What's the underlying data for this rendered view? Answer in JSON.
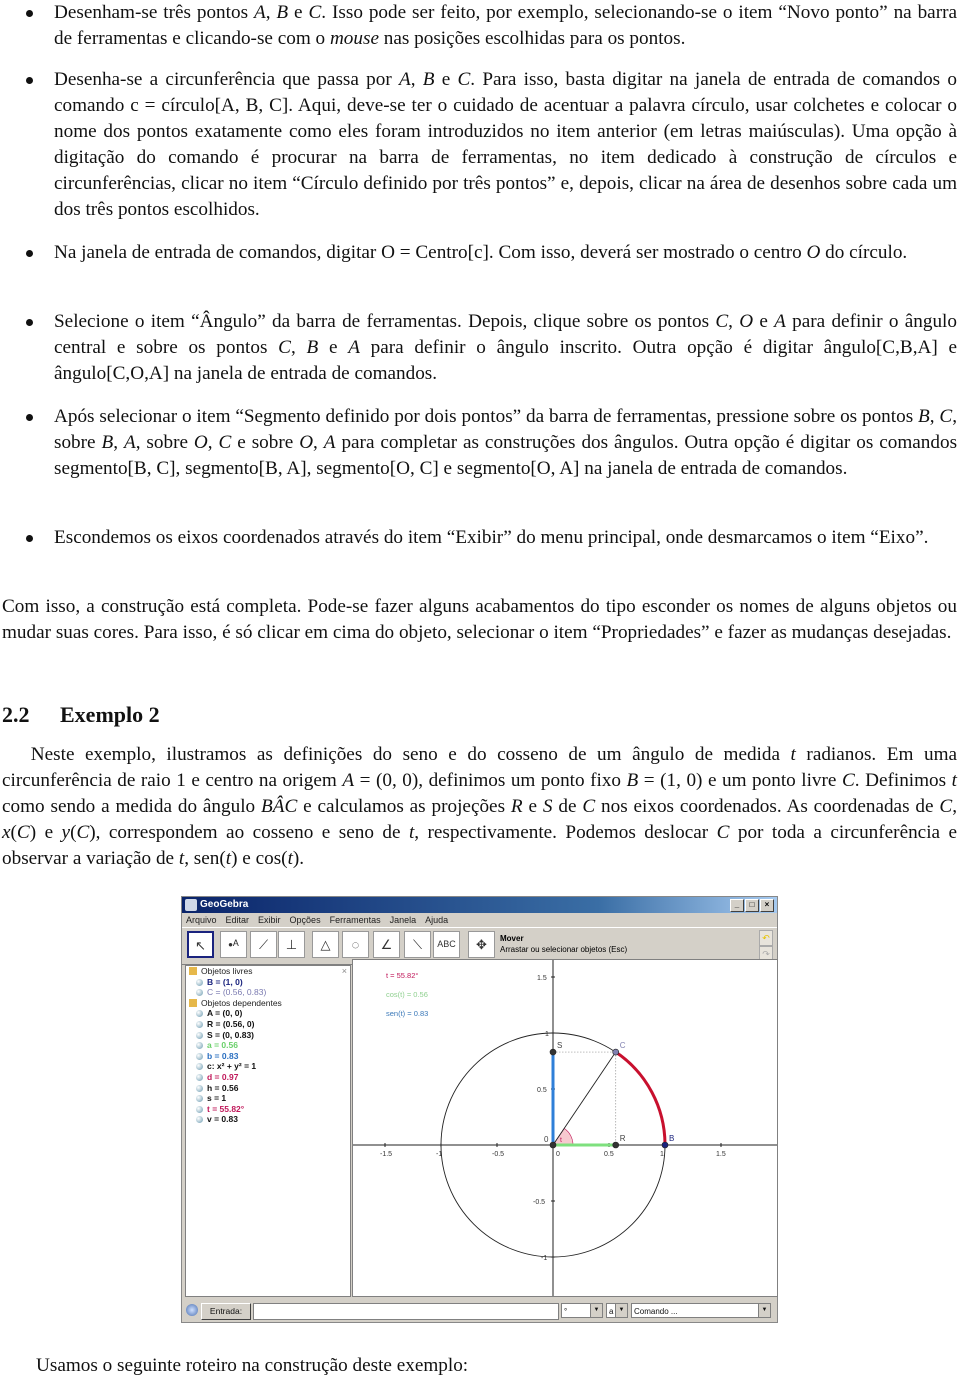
{
  "bullets": [
    {
      "html": "Desenham-se três pontos <i>A</i>, <i>B</i> e <i>C</i>. Isso pode ser feito, por exemplo, selecionando-se o item “Novo ponto” na barra de ferramentas e clicando-se com o <i>mouse</i> nas posições escolhidas para os pontos."
    },
    {
      "html": "Desenha-se a circunferência que passa por <i>A</i>, <i>B</i> e <i>C</i>. Para isso, basta digitar na janela de entrada de comandos o comando c = círculo[A, B, C]. Aqui, deve-se ter o cuidado de acentuar a palavra círculo, usar colchetes e colocar o nome dos pontos exatamente como eles foram introduzidos no item anterior (em letras maiúsculas). Uma opção à digitação do comando é procurar na barra de ferramentas, no item dedicado à construção de círculos e circunferências, clicar no item “Círculo definido por três pontos” e, depois, clicar na área de desenhos sobre cada um dos três pontos escolhidos."
    },
    {
      "html": "Na janela de entrada de comandos, digitar O = Centro[c]. Com isso, deverá ser mostrado o centro <i>O</i> do círculo."
    },
    {
      "html": "Selecione o item “Ângulo” da barra de ferramentas. Depois, clique sobre os pontos <i>C</i>, <i>O</i> e <i>A</i> para definir o ângulo central e sobre os pontos <i>C</i>, <i>B</i> e <i>A</i> para definir o ângulo inscrito. Outra opção é digitar ângulo[C,B,A] e ângulo[C,O,A] na janela de entrada de comandos."
    },
    {
      "html": "Após selecionar o item “Segmento definido por dois pontos” da barra de ferramentas, pressione sobre os pontos <i>B</i>, <i>C</i>, sobre <i>B</i>, <i>A</i>, sobre <i>O</i>, <i>C</i> e sobre <i>O</i>, <i>A</i> para completar as construções dos ângulos. Outra opção é digitar os comandos segmento[B, C], segmento[B, A], segmento[O, C] e segmento[O, A] na janela de entrada de comandos."
    },
    {
      "html": "Escondemos os eixos coordenados através do item “Exibir” do menu principal, onde desmarcamos o item “Eixo”."
    }
  ],
  "conclusion": "Com isso, a construção está completa. Pode-se fazer alguns acabamentos do tipo esconder os nomes de alguns objetos ou mudar suas cores. Para isso, é só clicar em cima do objeto, selecionar o item “Propriedades” e fazer as mudanças desejadas.",
  "section": {
    "number": "2.2",
    "title": "Exemplo 2"
  },
  "example_paragraph": "&emsp;&ensp;Neste exemplo, ilustramos as definições do seno e do cosseno de um ângulo de medida <i>t</i> radianos. Em uma circunferência de raio 1 e centro na origem <i>A</i> = (0, 0), definimos um ponto fixo <i>B</i> = (1, 0) e um ponto livre <i>C</i>. Definimos <i>t</i> como sendo a medida do ângulo <i>BÂC</i> e calculamos as projeções <i>R</i> e <i>S</i> de <i>C</i> nos eixos coordenados. As coordenadas de <i>C</i>, <i>x</i>(<i>C</i>) e <i>y</i>(<i>C</i>), correspondem ao cosseno e seno de <i>t</i>, respectivamente. Podemos deslocar <i>C</i> por toda a circunferência e observar a variação de <i>t</i>, sen(<i>t</i>) e cos(<i>t</i>).",
  "closing_line": "Usamos o seguinte roteiro na construção deste exemplo:",
  "geogebra": {
    "title": "GeoGebra",
    "window_buttons": [
      "_",
      "□",
      "×"
    ],
    "menu": [
      "Arquivo",
      "Editar",
      "Exibir",
      "Opções",
      "Ferramentas",
      "Janela",
      "Ajuda"
    ],
    "tools": [
      {
        "name": "move",
        "glyph": "↖"
      },
      {
        "name": "new-point",
        "glyph": "•ᴬ"
      },
      {
        "name": "line",
        "glyph": "⟋"
      },
      {
        "name": "perpendicular",
        "glyph": "⊥"
      },
      {
        "name": "polygon",
        "glyph": "△"
      },
      {
        "name": "circle",
        "glyph": "◌"
      },
      {
        "name": "angle",
        "glyph": "∠"
      },
      {
        "name": "reflect",
        "glyph": "⟍"
      },
      {
        "name": "text",
        "glyph": "ABC"
      },
      {
        "name": "move-view",
        "glyph": "✥"
      }
    ],
    "tool_help": {
      "title": "Mover",
      "description": "Arrastar ou selecionar objetos (Esc)"
    },
    "algebra": {
      "free_label": "Objetos livres",
      "dependent_label": "Objetos dependentes",
      "free": [
        {
          "text": "B = (1, 0)",
          "color": "#1a237e"
        },
        {
          "text": "C = (0.56, 0.83)",
          "color": "#7a7ab0",
          "normal": true
        }
      ],
      "dependent": [
        {
          "text": "A = (0, 0)",
          "color": "#111"
        },
        {
          "text": "R = (0.56, 0)",
          "color": "#111"
        },
        {
          "text": "S = (0, 0.83)",
          "color": "#111"
        },
        {
          "text": "a = 0.56",
          "color": "#6ad06a"
        },
        {
          "text": "b = 0.83",
          "color": "#2a6fc0"
        },
        {
          "text": "c: x² + y² = 1",
          "color": "#111"
        },
        {
          "text": "d = 0.97",
          "color": "#c0185a"
        },
        {
          "text": "h = 0.56",
          "color": "#111"
        },
        {
          "text": "s = 1",
          "color": "#111"
        },
        {
          "text": "t = 55.82°",
          "color": "#c0185a"
        },
        {
          "text": "v = 0.83",
          "color": "#111"
        }
      ]
    },
    "graphics_texts": [
      {
        "text": "t = 55.82°",
        "color": "#c0185a"
      },
      {
        "text": "cos(t) = 0.56",
        "color": "#8fd08f"
      },
      {
        "text": "sen(t) = 0.83",
        "color": "#3a78b8"
      }
    ],
    "points": [
      {
        "label": "A",
        "x": 0,
        "y": 0,
        "display": "0"
      },
      {
        "label": "B",
        "x": 1,
        "y": 0
      },
      {
        "label": "C",
        "x": 0.56,
        "y": 0.83
      },
      {
        "label": "R",
        "x": 0.56,
        "y": 0
      },
      {
        "label": "S",
        "x": 0,
        "y": 0.83
      }
    ],
    "angle_label": "t",
    "x_ticks": [
      "-1.5",
      "-1",
      "-0.5",
      "0",
      "0.5",
      "1",
      "1.5"
    ],
    "y_ticks": [
      "1.5",
      "1",
      "0.5",
      "-0.5",
      "-1"
    ],
    "colors": {
      "arc": "#c8102e",
      "cos_segment": "#7ee07e",
      "sin_segment": "#2f7fd8",
      "angle_fill": "#f7c9cf"
    },
    "input_bar": {
      "button": "Entrada:",
      "value": "",
      "symbol_combo": "°",
      "greek_combo": "a",
      "command_combo": "Comando ..."
    }
  }
}
